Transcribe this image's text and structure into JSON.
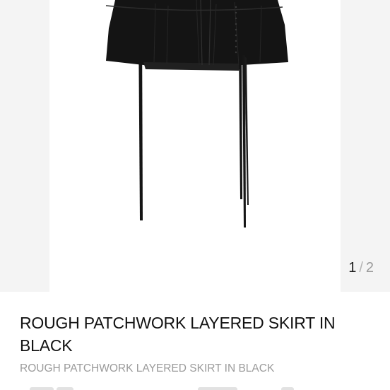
{
  "gallery": {
    "current_page": "1",
    "separator": "/",
    "total_pages": "2",
    "image": "black-layered-skirt-product-photo"
  },
  "product": {
    "title": "ROUGH PATCHWORK LAYERED SKIRT IN BLACK",
    "subtitle": "ROUGH PATCHWORK LAYERED SKIRT IN BLACK"
  },
  "colors": {
    "gallery_background": "#f4f4f4",
    "title_text": "#121212",
    "subtitle_text": "#9b9b9b",
    "pager_active": "#1c1c1c",
    "pager_inactive": "#9a9a9a",
    "skirt": "#141414"
  }
}
